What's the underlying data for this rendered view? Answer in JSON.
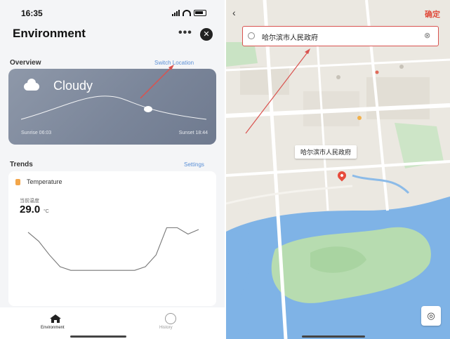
{
  "status": {
    "time": "16:35"
  },
  "app": {
    "title": "Environment",
    "more_icon": "more-icon",
    "close_icon": "close-icon"
  },
  "overview": {
    "label": "Overview",
    "link": "Switch Location",
    "weather": "Cloudy",
    "sunrise": "Sunrise 06:03",
    "sunset": "Sunset 18:44"
  },
  "trends": {
    "label": "Trends",
    "link": "Settings",
    "metric": "Temperature",
    "sub_label": "当前温度",
    "value": "29.0",
    "unit": "°C"
  },
  "chart_data": {
    "type": "line",
    "title": "",
    "series": [
      {
        "values": [
          31,
          30,
          28.5,
          27.2,
          26.8,
          26.8,
          26.8,
          26.8,
          26.8,
          26.8,
          26.8,
          27.2,
          28.5,
          31.5,
          31.5,
          30.8,
          31.3
        ]
      }
    ],
    "ylim": [
      25.5,
      32
    ],
    "grid": false
  },
  "tabbar": {
    "home": "Environment",
    "history": "History"
  },
  "map": {
    "back_icon": "back-arrow-icon",
    "confirm": "确定",
    "search_value": "哈尔滨市人民政府",
    "callout": "哈尔滨市人民政府",
    "locate_icon": "locate-icon"
  },
  "colors": {
    "accent_link": "#5a8fd6",
    "confirm_red": "#e04a3a",
    "annotation_red": "#d9534f",
    "weather_card": "#7b869a",
    "pin": "#e74c3c"
  }
}
